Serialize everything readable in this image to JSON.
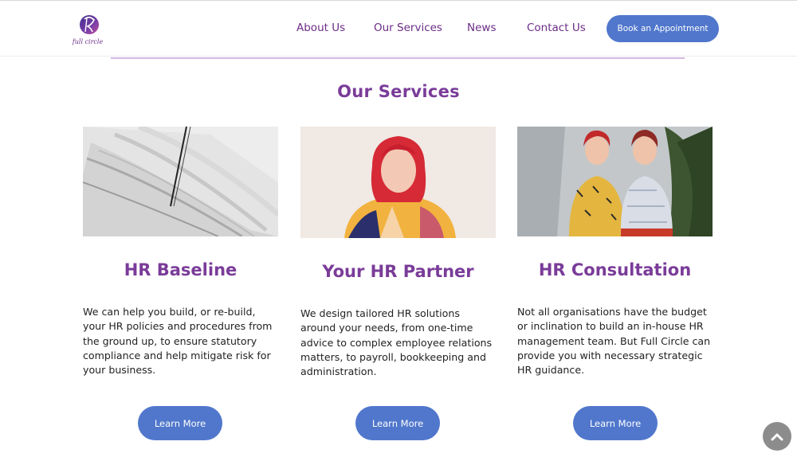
{
  "header": {
    "logo_alt": "full circle",
    "nav": [
      {
        "label": "About Us"
      },
      {
        "label": "Our Services"
      },
      {
        "label": "News"
      },
      {
        "label": "Contact Us"
      }
    ],
    "book_button": "Book an Appointment"
  },
  "main": {
    "section_title": "Our Services",
    "cards": [
      {
        "title": "HR Baseline",
        "text": "We can help you build, or re-build, your HR policies and procedures from the ground up, to ensure statutory compliance and help mitigate risk for your business.",
        "button": "Learn More"
      },
      {
        "title": "Your HR Partner",
        "text": "We design tailored HR solutions around your needs, from one-time advice to complex employee relations matters, to payroll, bookkeeping and administration.",
        "button": "Learn More"
      },
      {
        "title": "HR Consultation",
        "text": "Not all organisations have the budget or inclination to build an in-house HR management team. But Full Circle can provide you with necessary strategic HR guidance.",
        "button": "Learn More"
      }
    ]
  },
  "colors": {
    "brand_purple": "#7a3c99",
    "button_blue": "#5077cc",
    "divider": "#d6b7e6"
  },
  "icons": {
    "scroll_top": "chevron-up-icon"
  }
}
